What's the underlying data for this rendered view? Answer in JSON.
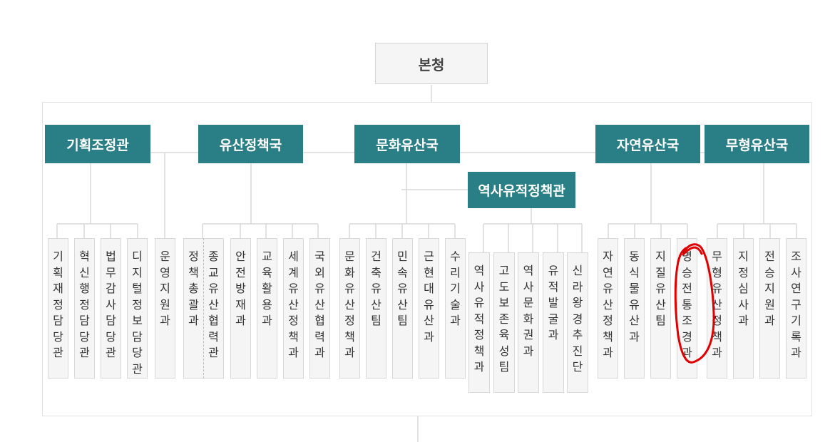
{
  "root": "본청",
  "groups": [
    {
      "label": "기획조정관",
      "units": [
        "기획재정담당관",
        "혁신행정담당관",
        "법무감사담당관",
        "디지털정보담당관"
      ]
    },
    {
      "label": "유산정책국",
      "units": [
        "운영지원과",
        "정책총괄과",
        "종교유산협력관",
        "안전방재과",
        "교육활용과",
        "세계유산정책과",
        "국외유산협력과"
      ]
    },
    {
      "label": "문화유산국",
      "units": [
        "문화유산정책과",
        "건축유산팀",
        "민속유산팀",
        "근현대유산과",
        "수리기술과"
      ]
    },
    {
      "label": "역사유적정책관",
      "units": [
        "역사유적정책과",
        "고도보존육성팀",
        "역사문화권과",
        "유적발굴과",
        "신라왕경추진단"
      ]
    },
    {
      "label": "자연유산국",
      "units": [
        "자연유산정책과",
        "동식물유산과",
        "지질유산팀",
        "명승전통조경과"
      ]
    },
    {
      "label": "무형유산국",
      "units": [
        "무형유산정책과",
        "지정심사과",
        "전승지원과",
        "조사연구기록과"
      ]
    }
  ],
  "colors": {
    "header": "#2a7f86",
    "annotation": "#e00000"
  }
}
